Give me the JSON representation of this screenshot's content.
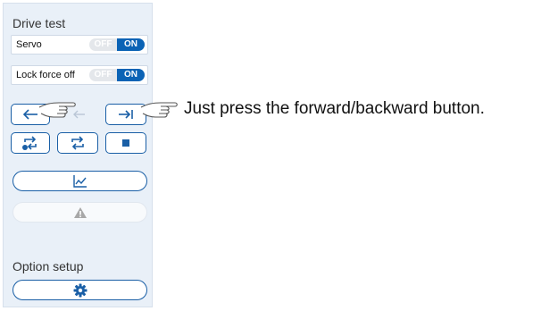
{
  "drive_test": {
    "title": "Drive test",
    "servo": {
      "label": "Servo",
      "off": "OFF",
      "on": "ON",
      "state": "on"
    },
    "lock_force_off": {
      "label": "Lock force off",
      "off": "OFF",
      "on": "ON",
      "state": "on"
    },
    "buttons": {
      "backward_icon": "arrow-left-icon",
      "backward_disabled_icon": "arrow-left-disabled-icon",
      "forward_icon": "arrow-right-bar-icon",
      "cycle_one_icon": "repeat-once-icon",
      "cycle_icon": "repeat-icon",
      "stop_icon": "stop-icon",
      "graph_icon": "chart-icon",
      "alarm_icon": "warning-icon"
    }
  },
  "option_setup": {
    "title": "Option setup",
    "settings_icon": "gear-icon"
  },
  "annotation": {
    "text": "Just press the forward/backward button."
  },
  "colors": {
    "accent": "#1a5fa6",
    "toggle_on": "#0b63b5",
    "panel_bg": "#e9f0f8"
  }
}
